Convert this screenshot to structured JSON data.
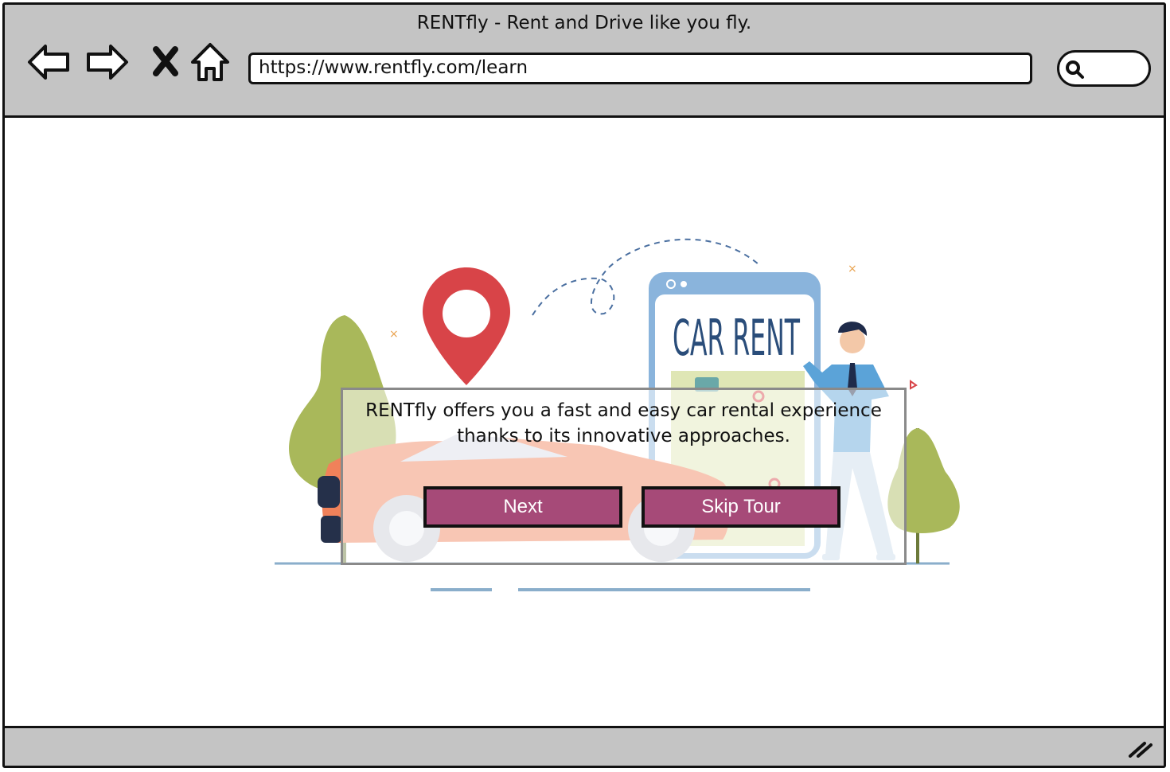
{
  "browser": {
    "title": "RENTfly  - Rent and Drive like you fly.",
    "url": "https://www.rentfly.com/learn",
    "nav_icons": [
      "back-arrow-icon",
      "forward-arrow-icon",
      "close-icon",
      "home-icon"
    ],
    "search_icon": "search-icon"
  },
  "illustration": {
    "phone_text": "CAR RENT"
  },
  "tour": {
    "message": "RENTfly offers you a fast and easy car rental experience thanks to its innovative approaches.",
    "next_label": "Next",
    "skip_label": "Skip Tour"
  },
  "colors": {
    "button": "#a64a78",
    "chrome": "#c4c4c4",
    "pin": "#d84448",
    "phone": "#8ab4dc"
  }
}
